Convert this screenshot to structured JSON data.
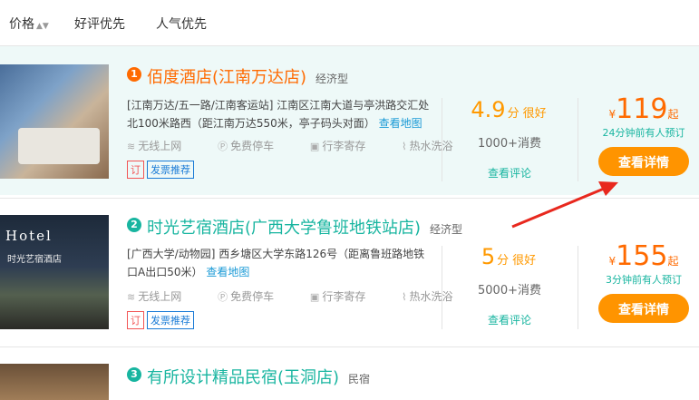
{
  "sort": {
    "price": "价格",
    "price_arrow": "▲▼",
    "rating": "好评优先",
    "popularity": "人气优先"
  },
  "hotels": [
    {
      "rank": "1",
      "name": "佰度酒店(江南万达店)",
      "type": "经济型",
      "address": "[江南万达/五一路/江南客运站] 江南区江南大道与亭洪路交汇处北100米路西（距江南万达550米，亭子码头对面）",
      "map_link": "查看地图",
      "amenities": [
        "无线上网",
        "免费停车",
        "行李寄存",
        "热水洗浴"
      ],
      "amenity_icons": [
        "wifi-icon",
        "parking-icon",
        "luggage-icon",
        "shower-icon"
      ],
      "tags": [
        "订",
        "发票推荐"
      ],
      "score": "4.9",
      "score_unit": "分",
      "score_text": "很好",
      "sales": "1000+消费",
      "review_link": "查看评论",
      "currency": "¥",
      "price": "119",
      "price_suffix": "起",
      "booked": "24分钟前有人预订",
      "button": "查看详情"
    },
    {
      "rank": "2",
      "name": "时光艺宿酒店(广西大学鲁班地铁站店)",
      "type": "经济型",
      "address": "[广西大学/动物园] 西乡塘区大学东路126号（距离鲁班路地铁口A出口50米）",
      "map_link": "查看地图",
      "amenities": [
        "无线上网",
        "免费停车",
        "行李寄存",
        "热水洗浴"
      ],
      "amenity_icons": [
        "wifi-icon",
        "parking-icon",
        "luggage-icon",
        "shower-icon"
      ],
      "tags": [
        "订",
        "发票推荐"
      ],
      "score": "5",
      "score_unit": "分",
      "score_text": "很好",
      "sales": "5000+消费",
      "review_link": "查看评论",
      "currency": "¥",
      "price": "155",
      "price_suffix": "起",
      "booked": "3分钟前有人预订",
      "button": "查看详情",
      "photo_sign": "Hotel",
      "photo_sub": "时光艺宿酒店"
    },
    {
      "rank": "3",
      "name": "有所设计精品民宿(玉洞店)",
      "type": "民宿"
    }
  ],
  "colors": {
    "accent_orange": "#ff6a00",
    "accent_teal": "#18b5a0",
    "button": "#ff9400",
    "annotation_arrow": "#e8281e"
  }
}
